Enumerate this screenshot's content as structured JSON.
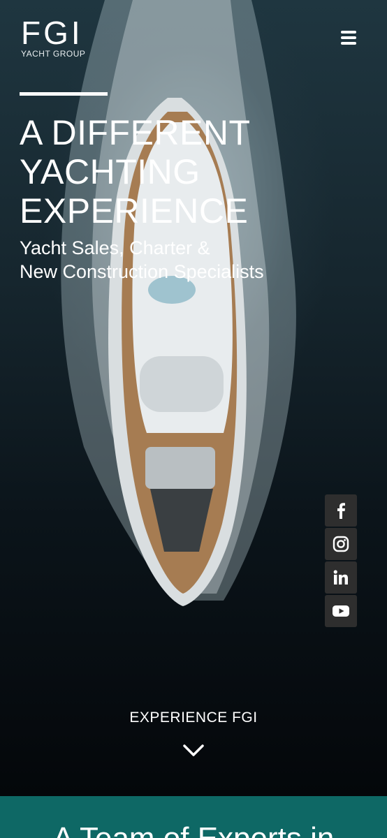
{
  "header": {
    "logo_text": "FGI",
    "logo_subtext": "YACHT GROUP",
    "menu_icon": "hamburger-icon"
  },
  "hero": {
    "headline_line1": "A DIFFERENT",
    "headline_line2": "YACHTING",
    "headline_line3": "EXPERIENCE",
    "subhead_line1": "Yacht Sales, Charter &",
    "subhead_line2": "New Construction Specialists",
    "cta_label": "EXPERIENCE FGI",
    "cta_icon": "chevron-down-icon"
  },
  "social": [
    {
      "icon": "facebook-icon"
    },
    {
      "icon": "instagram-icon"
    },
    {
      "icon": "linkedin-icon"
    },
    {
      "icon": "youtube-icon"
    }
  ],
  "section": {
    "title": "A Team of Experts in"
  },
  "colors": {
    "accent_teal": "#0e6865",
    "social_bg": "#2e2e2e",
    "text": "#ffffff"
  }
}
